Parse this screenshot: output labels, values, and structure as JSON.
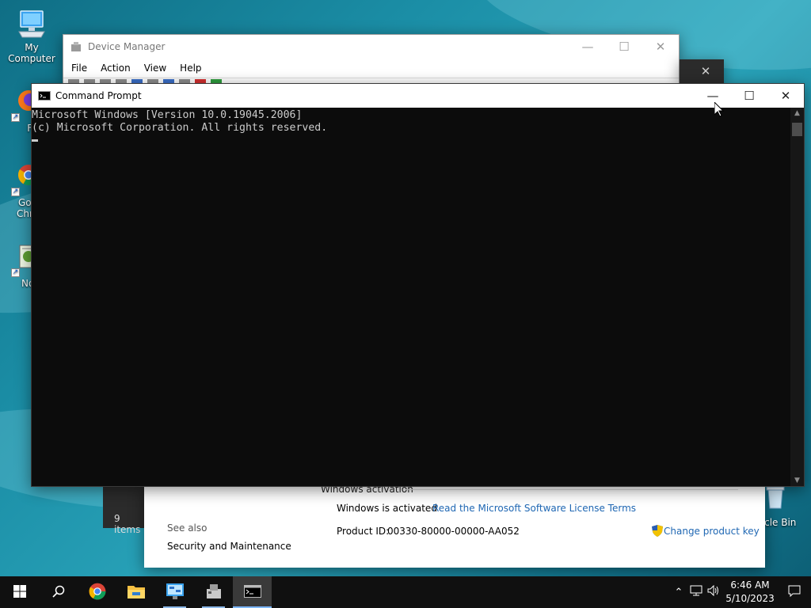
{
  "desktop": {
    "icons": [
      {
        "label": "My Computer"
      },
      {
        "label": "Fire"
      },
      {
        "label": "Goo Chro"
      },
      {
        "label": "Notep"
      },
      {
        "label": "ycle Bin"
      }
    ]
  },
  "device_manager": {
    "title": "Device Manager",
    "menu": [
      "File",
      "Action",
      "View",
      "Help"
    ]
  },
  "command_prompt": {
    "title": "Command Prompt",
    "lines": [
      "Microsoft Windows [Version 10.0.19045.2006]",
      "(c) Microsoft Corporation. All rights reserved."
    ]
  },
  "system_properties": {
    "section_heading": "Windows activation",
    "activation_status": "Windows is activated",
    "license_link": "Read the Microsoft Software License Terms",
    "product_id_label": "Product ID:",
    "product_id_value": "00330-80000-00000-AA052",
    "change_key_link": "Change product key",
    "see_also_label": "See also",
    "see_also_link": "Security and Maintenance"
  },
  "explorer": {
    "status_text": "9 items"
  },
  "taskbar": {
    "apps": [
      "start-icon",
      "search-icon",
      "chrome-icon",
      "file-explorer-icon",
      "control-panel-icon",
      "device-manager-icon",
      "command-prompt-icon"
    ],
    "clock_time": "6:46 AM",
    "clock_date": "5/10/2023"
  },
  "colors": {
    "link": "#1f67b3",
    "console_bg": "#0c0c0c",
    "console_fg": "#cccccc",
    "taskbar_bg": "#101010"
  }
}
